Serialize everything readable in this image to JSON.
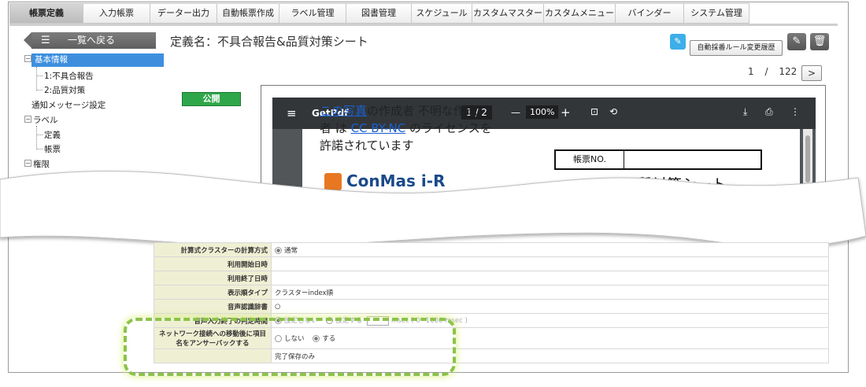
{
  "tabs": [
    "帳票定義",
    "入力帳票",
    "データー出力",
    "自動帳票作成",
    "ラベル管理",
    "図書管理",
    "スケジュール",
    "カスタムマスター",
    "カスタムメニュー",
    "バインダー",
    "システム管理"
  ],
  "back_button": {
    "label": "一覧へ戻る"
  },
  "page_title": "定義名：不具合報告&品質対策シート",
  "auto_numbering_history_label": "自動採番ルール変更履歴",
  "tree": {
    "basic_info": "基本情報",
    "item1": "1:不具合報告",
    "item2": "2:品質対策",
    "notify": "通知メッセージ設定",
    "label": "ラベル",
    "label_def": "定義",
    "label_form": "帳票",
    "permission": "権限"
  },
  "pager": {
    "current": "1",
    "separator": "/",
    "total": "122",
    "next": ">"
  },
  "public_badge": "公開",
  "pdf_viewer": {
    "title": "GetPdf",
    "page": "1 / 2",
    "zoom_minus": "—",
    "zoom": "100%",
    "zoom_plus": "+",
    "form_no_label": "帳票NO.",
    "logo_text": "ConMas i-R",
    "form_title_fragment": "品質対策シート"
  },
  "license_overlay": {
    "link1": "この写真",
    "text1": "の作成者 不明な作成",
    "text2": "者 は",
    "link2": "CC BY-NC",
    "text3": "のライセンスを",
    "text4": "許諾されています"
  },
  "table": [
    {
      "label": "計算式クラスターの計算方式",
      "value": "通常"
    },
    {
      "label": "利用開始日時",
      "value": ""
    },
    {
      "label": "利用終了日時",
      "value": ""
    },
    {
      "label": "表示順タイプ",
      "value": "クラスターindex順"
    },
    {
      "label": "音声認識辞書",
      "value": "○"
    },
    {
      "label": "音声入力終了の判定時間",
      "opt1": "設定しない",
      "opt2": "設定する",
      "unit": "msec ( 0~1000 msec )"
    },
    {
      "label": "ネットワーク接続への移動後に項目名をアンサーバックする",
      "opt1": "しない",
      "opt2": "する"
    },
    {
      "label": "",
      "value": "完了保存のみ"
    }
  ],
  "colors": {
    "accent": "#3d8fde",
    "public_green": "#2fa64a",
    "highlight": "#8bc34a"
  }
}
